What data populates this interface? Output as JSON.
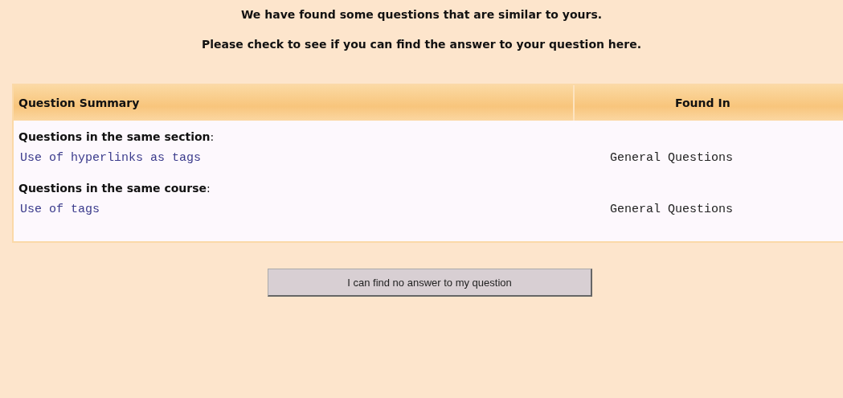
{
  "intro": [
    "We have found some questions that are similar to yours.",
    "Please check to see if you can find the answer to your question here."
  ],
  "table": {
    "columns": [
      "Question Summary",
      "Found In"
    ],
    "groups": [
      {
        "heading": "**Questions in the same section**:",
        "rows": [
          {
            "question": "Use of hyperlinks as tags",
            "found_in": "General Questions"
          }
        ]
      },
      {
        "heading": "**Questions in the same course**:",
        "rows": [
          {
            "question": "Use of tags",
            "found_in": "General Questions"
          }
        ]
      }
    ]
  },
  "button": "I can find no answer to my question"
}
